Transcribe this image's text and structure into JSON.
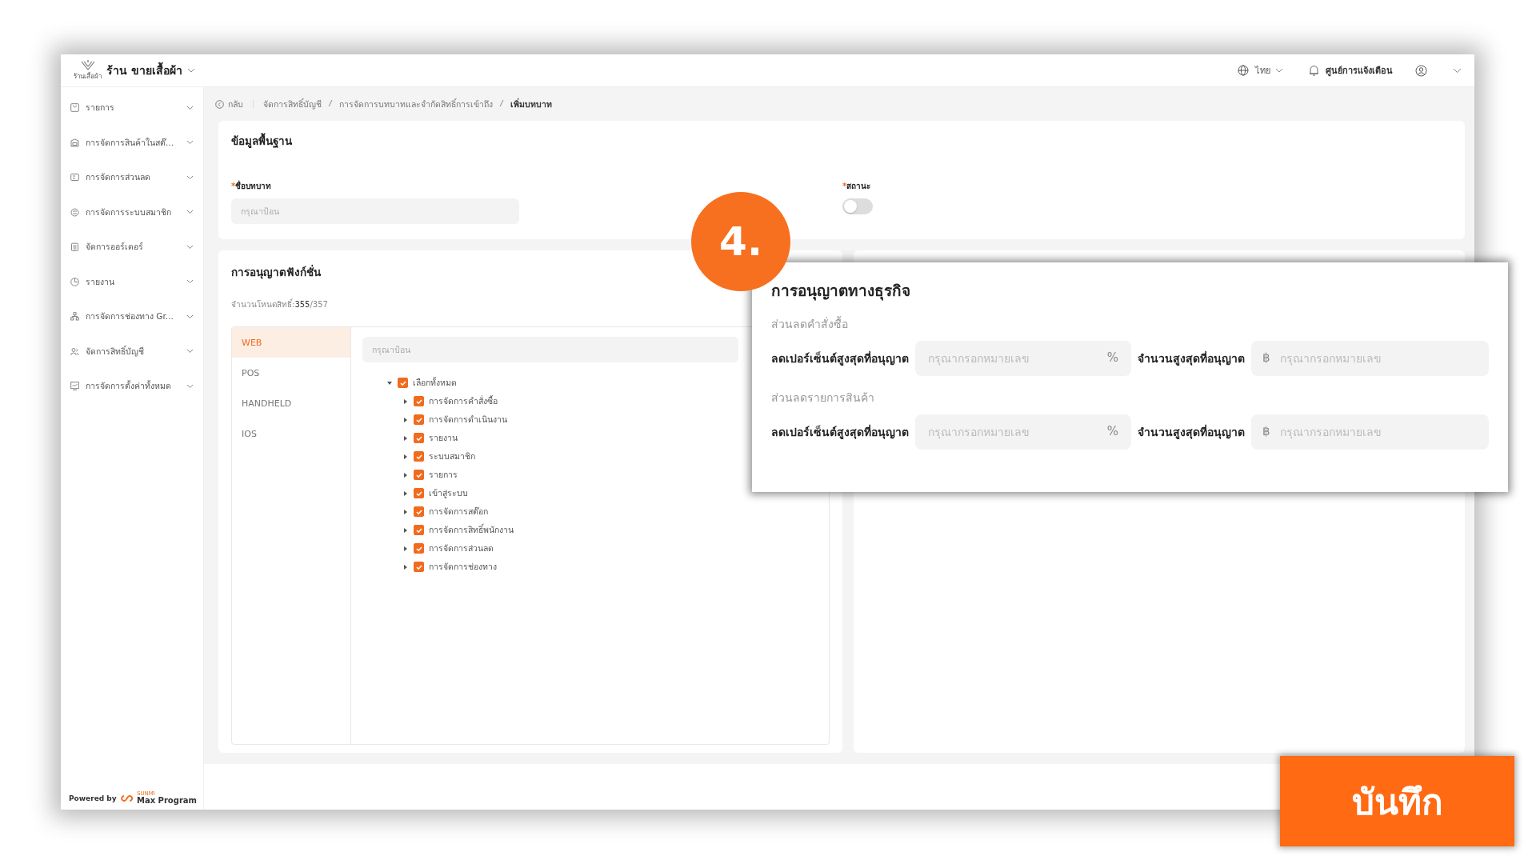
{
  "topbar": {
    "store_name": "ร้าน ขายเสื้อผ้า",
    "logo_caption": "ร้านเสื้อผ้า",
    "language": "ไทย",
    "notifications": "ศูนย์การแจ้งเตือน"
  },
  "sidebar": {
    "items": [
      {
        "label": "รายการ"
      },
      {
        "label": "การจัดการสินค้าในสต๊..."
      },
      {
        "label": "การจัดการส่วนลด"
      },
      {
        "label": "การจัดการระบบสมาชิก"
      },
      {
        "label": "จัดการออร์เดอร์"
      },
      {
        "label": "รายงาน"
      },
      {
        "label": "การจัดการช่องทาง Gr..."
      },
      {
        "label": "จัดการสิทธิ์บัญชี"
      },
      {
        "label": "การจัดการตั้งค่าทั้งหมด"
      }
    ],
    "powered_by": "Powered by",
    "brand_small": "SUNMI",
    "brand": "Max Program"
  },
  "breadcrumb": {
    "back": "กลับ",
    "items": [
      "จัดการสิทธิ์บัญชี",
      "การจัดการบทบาทและจำกัดสิทธิ์การเข้าถึง",
      "เพิ่มบทบาท"
    ]
  },
  "basic_info": {
    "title": "ข้อมูลพื้นฐาน",
    "required_mark": "*",
    "name_label": "ชื่อบทบาท",
    "name_placeholder": "กรุณาป้อน",
    "status_label": "สถานะ",
    "status_on": false
  },
  "function_permissions": {
    "title": "การอนุญาตฟังก์ชั่น",
    "count_label": "จำนวนโหนดสิทธิ์:",
    "count_selected": "355",
    "count_total": "/357",
    "platforms": [
      {
        "label": "WEB",
        "selected": true
      },
      {
        "label": "POS",
        "selected": false
      },
      {
        "label": "HANDHELD",
        "selected": false
      },
      {
        "label": "IOS",
        "selected": false
      }
    ],
    "search_placeholder": "กรุณาป้อน",
    "tree": {
      "label": "เลือกทั้งหมด",
      "checked": true,
      "expanded": true,
      "children": [
        {
          "label": "การจัดการคำสั่งซื้อ",
          "checked": true,
          "expanded": false
        },
        {
          "label": "การจัดการดำเนินงาน",
          "checked": true,
          "expanded": false
        },
        {
          "label": "รายงาน",
          "checked": true,
          "expanded": false
        },
        {
          "label": "ระบบสมาชิก",
          "checked": true,
          "expanded": false
        },
        {
          "label": "รายการ",
          "checked": true,
          "expanded": false
        },
        {
          "label": "เข้าสู่ระบบ",
          "checked": true,
          "expanded": false
        },
        {
          "label": "การจัดการสต๊อก",
          "checked": true,
          "expanded": false
        },
        {
          "label": "การจัดการสิทธิ์พนักงาน",
          "checked": true,
          "expanded": false
        },
        {
          "label": "การจัดการส่วนลด",
          "checked": true,
          "expanded": false
        },
        {
          "label": "การจัดการช่องทาง",
          "checked": true,
          "expanded": false
        }
      ]
    }
  },
  "step_badge": "4.",
  "business_permissions": {
    "title": "การอนุญาตทางธุรกิจ",
    "sections": [
      {
        "title": "ส่วนลดคำสั่งซื้อ",
        "percent_label": "ลดเปอร์เซ็นต์สูงสุดที่อนุญาต",
        "percent_placeholder": "กรุณากรอกหมายเลข",
        "percent_unit": "%",
        "amount_label": "จำนวนสูงสุดที่อนุญาต",
        "amount_unit": "฿",
        "amount_placeholder": "กรุณากรอกหมายเลข"
      },
      {
        "title": "ส่วนลดรายการสินค้า",
        "percent_label": "ลดเปอร์เซ็นต์สูงสุดที่อนุญาต",
        "percent_placeholder": "กรุณากรอกหมายเลข",
        "percent_unit": "%",
        "amount_label": "จำนวนสูงสุดที่อนุญาต",
        "amount_unit": "฿",
        "amount_placeholder": "กรุณากรอกหมายเลข"
      }
    ]
  },
  "save_button": "บันทึก"
}
